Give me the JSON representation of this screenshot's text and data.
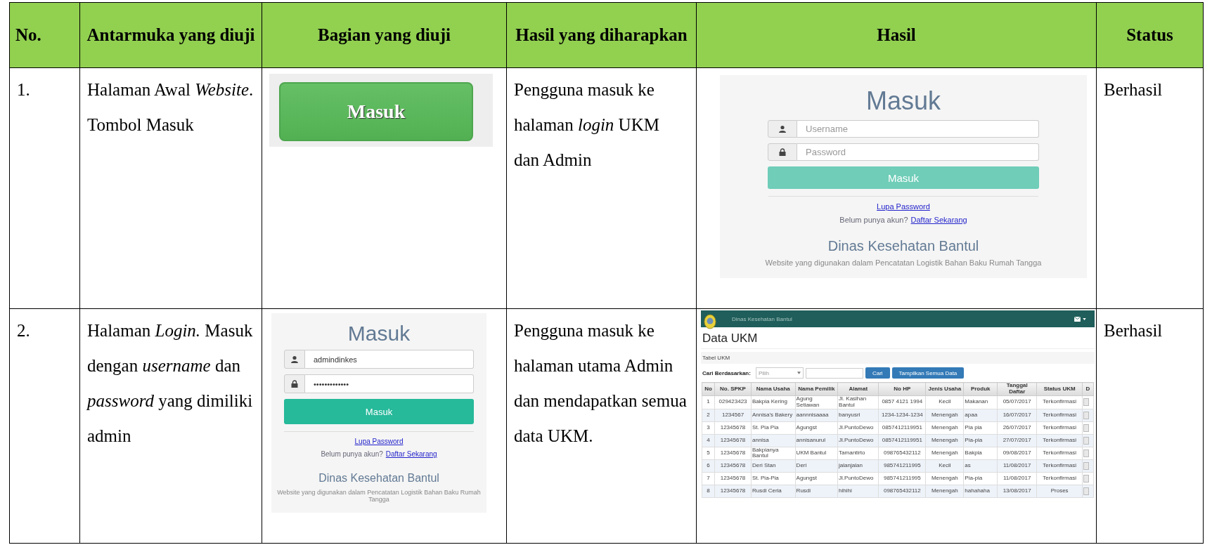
{
  "table": {
    "columns": [
      "No.",
      "Antarmuka yang diuji",
      "Bagian yang diuji",
      "Hasil yang diharapkan",
      "Hasil",
      "Status"
    ],
    "rows": [
      {
        "cells": [
          {
            "kind": "text",
            "text": "1."
          },
          {
            "kind": "text",
            "text": "Halaman Awal *Website*. Tombol Masuk"
          },
          {
            "kind": "button_image",
            "label": "Masuk"
          },
          {
            "kind": "text",
            "text": "Pengguna masuk ke halaman *login* UKM dan Admin"
          },
          {
            "kind": "login_form",
            "title": "Masuk",
            "fields": [
              {
                "kind": "user",
                "placeholder": "Username"
              },
              {
                "kind": "password",
                "placeholder": "Password"
              }
            ],
            "button": "Masuk",
            "forgot_link": "Lupa Password",
            "register_prompt": "Belum punya akun?",
            "register_link": "Daftar Sekarang",
            "org_name": "Dinas Kesehatan Bantul",
            "description": "Website yang digunakan dalam Pencatatan Logistik Bahan Baku Rumah Tangga"
          },
          {
            "kind": "text",
            "text": "Berhasil"
          }
        ]
      },
      {
        "cells": [
          {
            "kind": "text",
            "text": "2."
          },
          {
            "kind": "text",
            "text": "Halaman *Login.* Masuk dengan *username* dan *password* yang dimiliki admin"
          },
          {
            "kind": "login_form",
            "title": "Masuk",
            "fields": [
              {
                "kind": "user",
                "value": "admindinkes"
              },
              {
                "kind": "password",
                "value": "•••••••••••••"
              }
            ],
            "button": "Masuk",
            "forgot_link": "Lupa Password",
            "register_prompt": "Belum punya akun?",
            "register_link": "Daftar Sekarang",
            "org_name": "Dinas Kesehatan Bantul",
            "description": "Website yang digunakan dalam Pencatatan Logistik Bahan Baku Rumah Tangga"
          },
          {
            "kind": "text",
            "text": "Pengguna masuk ke halaman utama Admin dan mendapatkan semua data UKM."
          },
          {
            "kind": "data_page",
            "brand": "Dinas Kesehatan Bantul",
            "heading": "Data UKM",
            "panel_title": "Tabel UKM",
            "search_label": "Cari Berdasarkan:",
            "search_select": "Pilih",
            "search_button": "Cari",
            "show_all_button": "Tampilkan Semua Data",
            "columns": [
              "No",
              "No. SPKP",
              "Nama Usaha",
              "Nama Pemilik",
              "Alamat",
              "No HP",
              "Jenis Usaha",
              "Produk",
              "Tanggal Daftar",
              "Status UKM",
              "D"
            ],
            "rows": [
              [
                "1",
                "029423423",
                "Bakpia Kering",
                "Agung Setiawan",
                "Jl. Kasihan Bantul",
                "0857 4121 1994",
                "Kecil",
                "Makanan",
                "05/07/2017",
                "Terkonfirmasi"
              ],
              [
                "2",
                "1234567",
                "Annisa's Bakery",
                "aannnisaaaa",
                "banyusri",
                "1234-1234-1234",
                "Menengah",
                "apaa",
                "16/07/2017",
                "Terkonfirmasi"
              ],
              [
                "3",
                "12345678",
                "St. Pia Pia",
                "Agungst",
                "Jl.PuntoDewo",
                "0857412119951",
                "Menengah",
                "Pia pia",
                "26/07/2017",
                "Terkonfirmasi"
              ],
              [
                "4",
                "12345678",
                "annisa",
                "annisanurul",
                "Jl.PuntoDewo",
                "0857412119951",
                "Menengah",
                "Pia-pia",
                "27/07/2017",
                "Terkonfirmasi"
              ],
              [
                "5",
                "12345678",
                "Bakpianya Bantul",
                "UKM Bantul",
                "Tamantirto",
                "098765432112",
                "Menengah",
                "Bakpia",
                "09/08/2017",
                "Terkonfirmasi"
              ],
              [
                "6",
                "12345678",
                "Deri Stan",
                "Deri",
                "jalanjalan",
                "985741211995",
                "Kecil",
                "as",
                "11/08/2017",
                "Terkonfirmasi"
              ],
              [
                "7",
                "12345678",
                "St. Pia-Pia",
                "Agungst",
                "Jl.PuntoDewo",
                "985741211995",
                "Menengah",
                "Pia-pia",
                "11/08/2017",
                "Terkonfirmasi"
              ],
              [
                "8",
                "12345678",
                "Rusdi Ceria",
                "Rusdi",
                "hihihi",
                "098765432112",
                "Menengah",
                "hahahaha",
                "13/08/2017",
                "Proses"
              ]
            ]
          },
          {
            "kind": "text",
            "text": "Berhasil"
          }
        ]
      }
    ]
  }
}
